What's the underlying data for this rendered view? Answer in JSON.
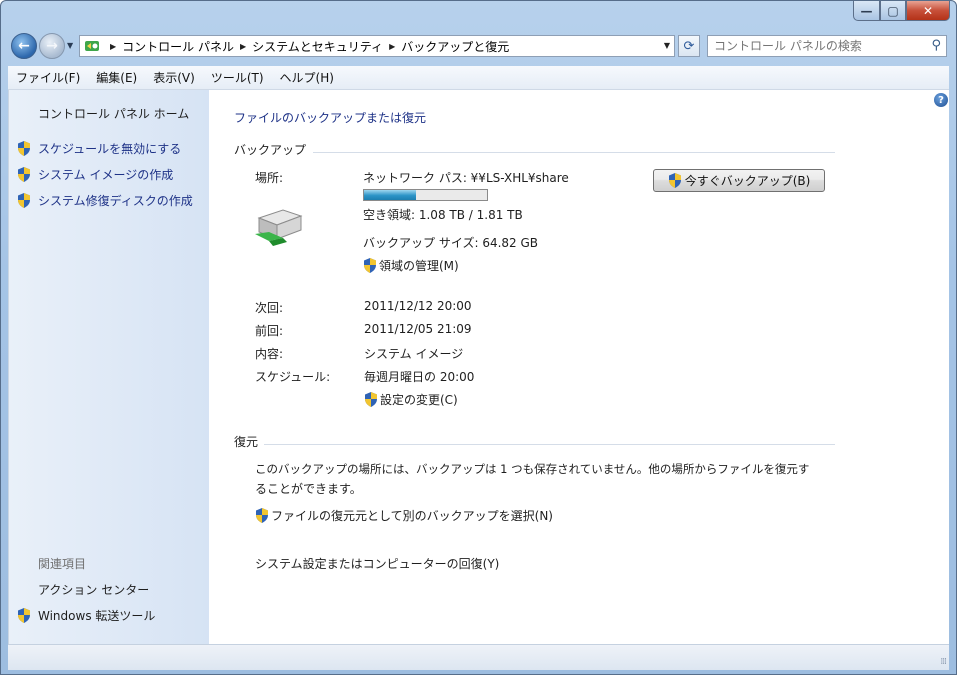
{
  "window": {
    "caption": {
      "minimize": "—",
      "maximize": "▢",
      "close": "✕"
    }
  },
  "nav": {
    "breadcrumbs": [
      "コントロール パネル",
      "システムとセキュリティ",
      "バックアップと復元"
    ],
    "search_placeholder": "コントロール パネルの検索"
  },
  "menu": [
    "ファイル(F)",
    "編集(E)",
    "表示(V)",
    "ツール(T)",
    "ヘルプ(H)"
  ],
  "sidebar": {
    "home": "コントロール パネル ホーム",
    "tasks": [
      "スケジュールを無効にする",
      "システム イメージの作成",
      "システム修復ディスクの作成"
    ],
    "related_heading": "関連項目",
    "related": [
      "アクション センター",
      "Windows 転送ツール"
    ]
  },
  "main": {
    "page_title": "ファイルのバックアップまたは復元",
    "backup": {
      "heading": "バックアップ",
      "location_label": "場所:",
      "location_value": "ネットワーク パス: ¥¥LS-XHL¥share",
      "usage_fraction": 0.42,
      "free_space": "空き領域: 1.08 TB / 1.81 TB",
      "backup_size": "バックアップ サイズ: 64.82 GB",
      "manage_space": "領域の管理(M)",
      "backup_now_button": "今すぐバックアップ(B)",
      "next_label": "次回:",
      "next_value": "2011/12/12 20:00",
      "last_label": "前回:",
      "last_value": "2011/12/05 21:09",
      "contents_label": "内容:",
      "contents_value": "システム イメージ",
      "schedule_label": "スケジュール:",
      "schedule_value": "毎週月曜日の 20:00",
      "change_settings": "設定の変更(C)"
    },
    "restore": {
      "heading": "復元",
      "message_line1": "このバックアップの場所には、バックアップは 1 つも保存されていません。他の場所からファイルを復元す",
      "message_line2": "ることができます。",
      "select_other": "ファイルの復元元として別のバックアップを選択(N)",
      "recover_system": "システム設定またはコンピューターの回復(Y)"
    }
  },
  "colors": {
    "link": "#1e3287",
    "accent": "#2c94c7"
  }
}
